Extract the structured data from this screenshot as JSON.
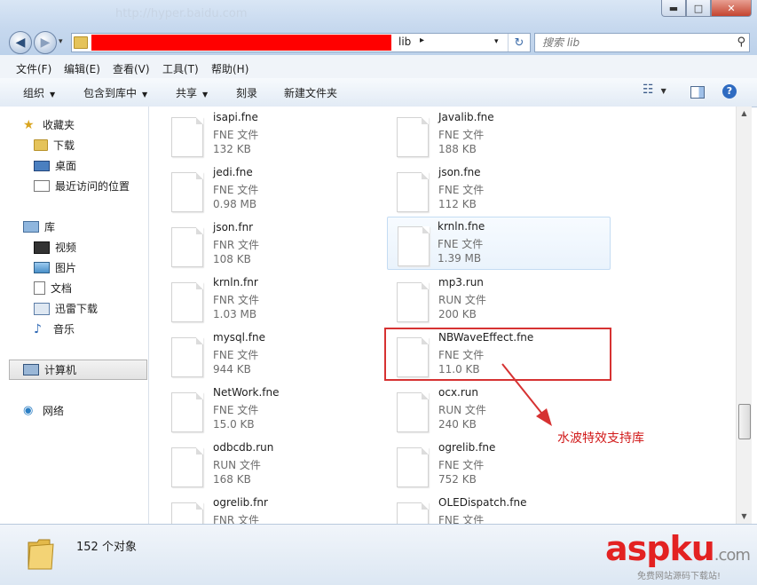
{
  "titlebar": {
    "ghost_url": "http://hyper.baidu.com",
    "minimize_glyph": "▬",
    "maximize_glyph": "□",
    "close_glyph": "✕"
  },
  "navbar": {
    "back_glyph": "◀",
    "forward_glyph": "▶",
    "address": {
      "crumb": "lib",
      "crumb_arrow": "▸",
      "dropdown_glyph": "▾",
      "refresh_glyph": "↻"
    },
    "search": {
      "placeholder": "搜索 lib",
      "icon": "search-icon",
      "glyph": "⚲"
    }
  },
  "menubar": {
    "items": [
      "文件(F)",
      "编辑(E)",
      "查看(V)",
      "工具(T)",
      "帮助(H)"
    ]
  },
  "commandbar": {
    "organize": "组织",
    "include_in_library": "包含到库中",
    "share": "共享",
    "burn": "刻录",
    "new_folder": "新建文件夹",
    "dropdown_glyph": "▼",
    "help_glyph": "?",
    "views_glyph": "☷"
  },
  "sidebar": {
    "favorites": {
      "label": "收藏夹",
      "icon": "star-icon",
      "glyph": "★"
    },
    "favorite_items": [
      {
        "label": "下载",
        "icon": "download-folder-icon"
      },
      {
        "label": "桌面",
        "icon": "desktop-icon"
      },
      {
        "label": "最近访问的位置",
        "icon": "recent-places-icon"
      }
    ],
    "libraries": {
      "label": "库",
      "icon": "library-icon"
    },
    "library_items": [
      {
        "label": "视频",
        "icon": "video-icon"
      },
      {
        "label": "图片",
        "icon": "picture-icon"
      },
      {
        "label": "文档",
        "icon": "document-icon"
      },
      {
        "label": "迅雷下载",
        "icon": "thunder-download-icon"
      },
      {
        "label": "音乐",
        "icon": "music-icon",
        "glyph": "♪"
      }
    ],
    "computer": {
      "label": "计算机",
      "icon": "computer-icon"
    },
    "network": {
      "label": "网络",
      "icon": "network-icon",
      "glyph": "◉"
    }
  },
  "files": [
    {
      "name": "isapi.fne",
      "type": "FNE 文件",
      "size": "132 KB"
    },
    {
      "name": "Javalib.fne",
      "type": "FNE 文件",
      "size": "188 KB"
    },
    {
      "name": "jedi.fne",
      "type": "FNE 文件",
      "size": "0.98 MB"
    },
    {
      "name": "json.fne",
      "type": "FNE 文件",
      "size": "112 KB"
    },
    {
      "name": "json.fnr",
      "type": "FNR 文件",
      "size": "108 KB"
    },
    {
      "name": "krnln.fne",
      "type": "FNE 文件",
      "size": "1.39 MB"
    },
    {
      "name": "krnln.fnr",
      "type": "FNR 文件",
      "size": "1.03 MB"
    },
    {
      "name": "mp3.run",
      "type": "RUN 文件",
      "size": "200 KB"
    },
    {
      "name": "mysql.fne",
      "type": "FNE 文件",
      "size": "944 KB"
    },
    {
      "name": "NBWaveEffect.fne",
      "type": "FNE 文件",
      "size": "11.0 KB"
    },
    {
      "name": "NetWork.fne",
      "type": "FNE 文件",
      "size": "15.0 KB"
    },
    {
      "name": "ocx.run",
      "type": "RUN 文件",
      "size": "240 KB"
    },
    {
      "name": "odbcdb.run",
      "type": "RUN 文件",
      "size": "168 KB"
    },
    {
      "name": "ogrelib.fne",
      "type": "FNE 文件",
      "size": "752 KB"
    },
    {
      "name": "ogrelib.fnr",
      "type": "FNR 文件",
      "size": ""
    },
    {
      "name": "OLEDispatch.fne",
      "type": "FNE 文件",
      "size": ""
    }
  ],
  "annotation": {
    "text": "水波特效支持库",
    "color": "#d11a1a"
  },
  "scrollbar": {
    "up_glyph": "▲",
    "down_glyph": "▼"
  },
  "status": {
    "count": "152 个对象"
  },
  "watermark": {
    "brand": "aspku",
    "suffix": ".com",
    "tagline": "免费网站源码下载站!"
  },
  "colors": {
    "accent": "#3a6aa8",
    "redaction": "#ff0000",
    "annotation": "#d63232"
  }
}
